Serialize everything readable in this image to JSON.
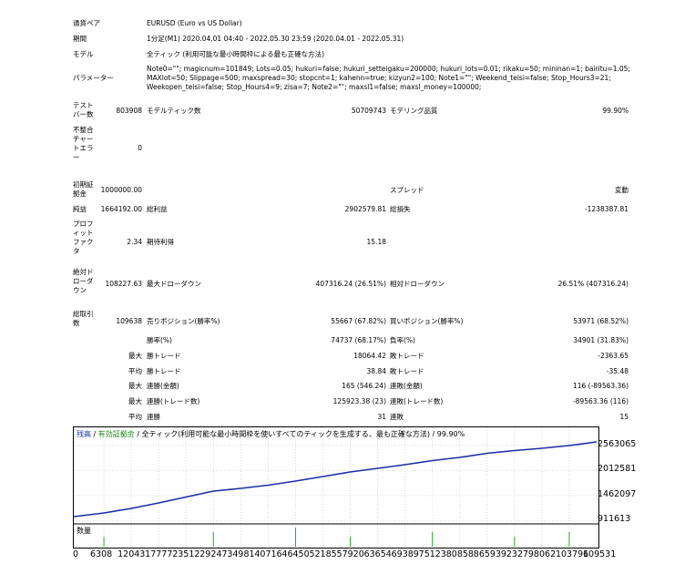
{
  "report": {
    "rows": [
      {
        "key": "row-pair",
        "label": "通貨ペア",
        "value": "EURUSD (Euro vs US Dollar)"
      },
      {
        "key": "row-period",
        "label": "期間",
        "value": "1分足(M1) 2020.04.01 04:40 - 2022.05.30 23:59 (2020.04.01 - 2022.05.31)"
      },
      {
        "key": "row-model",
        "label": "モデル",
        "value": "全ティック (利用可能な最小時間枠による最も正確な方法)"
      }
    ],
    "params_label": "パラメーター",
    "params_text": "Note0=\"\"; magicnum=101849; Lots=0.05; hukuri=false; hukuri_setteigaku=200000; hukuri_lots=0.01; rikaku=50; mininan=1; bairitu=1.05; MAXlot=50; Slippage=500; maxspread=30; stopcnt=1; kahenn=true; kizyun2=100; Note1=\"\"; Weekend_teisi=false; Stop_Hours3=21; Weekopen_teisi=false; Stop_Hours4=9; zisa=7; Note2=\"\"; maxsl1=false; maxsl_money=100000;",
    "test_bars_label": "テストバー数",
    "test_bars_value": "803908",
    "model_ticks_label": "モデルティック数",
    "model_ticks_value": "50709743",
    "model_quality_label": "モデリング品質",
    "model_quality_value": "99.90%",
    "mismatch_label": "不整合チャートエラー",
    "mismatch_value": "0",
    "initial_deposit_label": "初期証拠金",
    "initial_deposit_value": "1000000.00",
    "spread_label": "スプレッド",
    "spread_value": "変動",
    "net_profit_label": "純益",
    "net_profit_value": "1664192.00",
    "gross_profit_label": "総利益",
    "gross_profit_value": "2902579.81",
    "gross_loss_label": "総損失",
    "gross_loss_value": "-1238387.81",
    "profit_factor_label": "プロフィットファクタ",
    "profit_factor_value": "2.34",
    "expected_payoff_label": "期待利得",
    "expected_payoff_value": "15.18",
    "abs_dd_label": "絶対ドローダウン",
    "abs_dd_value": "108227.63",
    "max_dd_label": "最大ドローダウン",
    "max_dd_value": "407316.24 (26.51%)",
    "rel_dd_label": "相対ドローダウン",
    "rel_dd_value": "26.51% (407316.24)",
    "total_trades_label": "総取引数",
    "total_trades_value": "109638",
    "short_label": "売りポジション(勝率%)",
    "short_value": "55667 (67.82%)",
    "long_label": "買いポジション(勝率%)",
    "long_value": "53971 (68.52%)",
    "win_label": "勝率(%)",
    "win_value": "74737 (68.17%)",
    "loss_label": "負率(%)",
    "loss_value": "34901 (31.83%)",
    "largest_prefix": "最大",
    "average_prefix": "平均",
    "largest_win_label": "勝トレード",
    "largest_win_value": "18064.42",
    "largest_loss_label": "敗トレード",
    "largest_loss_value": "-2363.65",
    "avg_win_label": "勝トレード",
    "avg_win_value": "38.84",
    "avg_loss_label": "敗トレード",
    "avg_loss_value": "-35.48",
    "max_consec_win_amt_label": "連勝(金額)",
    "max_consec_win_amt_value": "165 (546.24)",
    "max_consec_loss_amt_label": "連敗(金額)",
    "max_consec_loss_amt_value": "116 (-89563.36)",
    "max_consec_win_trades_label": "連勝(トレード数)",
    "max_consec_win_trades_value": "125923.38 (23)",
    "max_consec_loss_trades_label": "連敗(トレード数)",
    "max_consec_loss_trades_value": "-89563.36 (116)",
    "avg_consec_win_label": "連勝",
    "avg_consec_win_value": "31",
    "avg_consec_loss_label": "連敗",
    "avg_consec_loss_value": "15"
  },
  "chart_title": {
    "balance": "残高",
    "sep1": " / ",
    "equity": "有効証拠金",
    "sep2": " / ",
    "rest": "全ティック(利用可能な最小時間枠を使いすべてのティックを生成する、最も正確な方法) / 99.90%"
  },
  "volume_label": "数量",
  "colors": {
    "balance": "#1a2ea8",
    "equity": "#1a8a1a",
    "volume": "#22aa22"
  },
  "chart_data": {
    "type": "line",
    "series": [
      {
        "name": "残高",
        "points": [
          [
            0,
            1000000
          ],
          [
            6308,
            1080000
          ],
          [
            12043,
            1180000
          ],
          [
            17777,
            1300000
          ],
          [
            23512,
            1430000
          ],
          [
            29247,
            1560000
          ],
          [
            34981,
            1620000
          ],
          [
            40716,
            1690000
          ],
          [
            46450,
            1780000
          ],
          [
            52185,
            1880000
          ],
          [
            57920,
            1980000
          ],
          [
            63654,
            2060000
          ],
          [
            69389,
            2140000
          ],
          [
            75123,
            2230000
          ],
          [
            80858,
            2300000
          ],
          [
            86593,
            2390000
          ],
          [
            92327,
            2450000
          ],
          [
            98062,
            2500000
          ],
          [
            103796,
            2560000
          ],
          [
            109531,
            2640000
          ]
        ]
      }
    ],
    "y_ticks": [
      "2563065",
      "2012581",
      "1462097",
      "911613"
    ],
    "y_tick_values": [
      2563065,
      2012581,
      1462097,
      911613
    ],
    "x_ticks": [
      "0",
      "6308",
      "12043",
      "17777",
      "23512",
      "29247",
      "34981",
      "40716",
      "46450",
      "52185",
      "57920",
      "63654",
      "69389",
      "75123",
      "80858",
      "86593",
      "92327",
      "98062",
      "103796",
      "109531"
    ],
    "xlim": [
      0,
      109531
    ],
    "ylim": [
      880000,
      2680000
    ],
    "volume_spikes": [
      [
        6308,
        1
      ],
      [
        29247,
        2
      ],
      [
        46450,
        3
      ],
      [
        57920,
        1
      ],
      [
        75123,
        2
      ],
      [
        92327,
        1
      ],
      [
        103796,
        2
      ]
    ]
  }
}
